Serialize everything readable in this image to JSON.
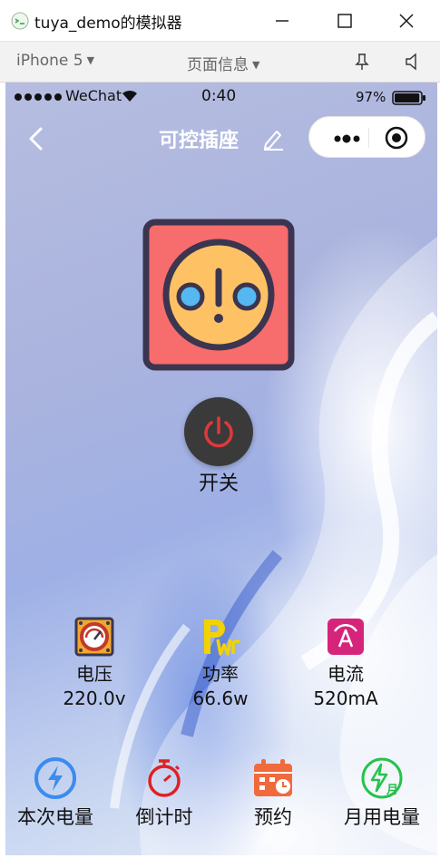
{
  "window": {
    "title": "tuya_demo的模拟器"
  },
  "toolbar": {
    "device": "iPhone 5",
    "page_info": "页面信息"
  },
  "status_bar": {
    "carrier": "WeChat",
    "time": "0:40",
    "battery": "97%",
    "battery_level": 0.97
  },
  "nav": {
    "title": "可控插座"
  },
  "switch": {
    "label": "开关"
  },
  "metrics": [
    {
      "label": "电压",
      "value": "220.0v",
      "icon": "voltage-gauge-icon"
    },
    {
      "label": "功率",
      "value": "66.6w",
      "icon": "power-pwr-icon"
    },
    {
      "label": "电流",
      "value": "520mA",
      "icon": "current-ammeter-icon"
    }
  ],
  "actions": [
    {
      "label": "本次电量",
      "icon": "lightning-circle-icon"
    },
    {
      "label": "倒计时",
      "icon": "stopwatch-icon"
    },
    {
      "label": "预约",
      "icon": "calendar-schedule-icon"
    },
    {
      "label": "月用电量",
      "icon": "monthly-energy-icon"
    }
  ],
  "colors": {
    "socket_bg": "#f76c6c",
    "socket_face": "#fec265",
    "socket_hole": "#55b8f0",
    "socket_border": "#3b3550",
    "power_button": "#3a3a3a",
    "power_icon": "#e0383b"
  }
}
